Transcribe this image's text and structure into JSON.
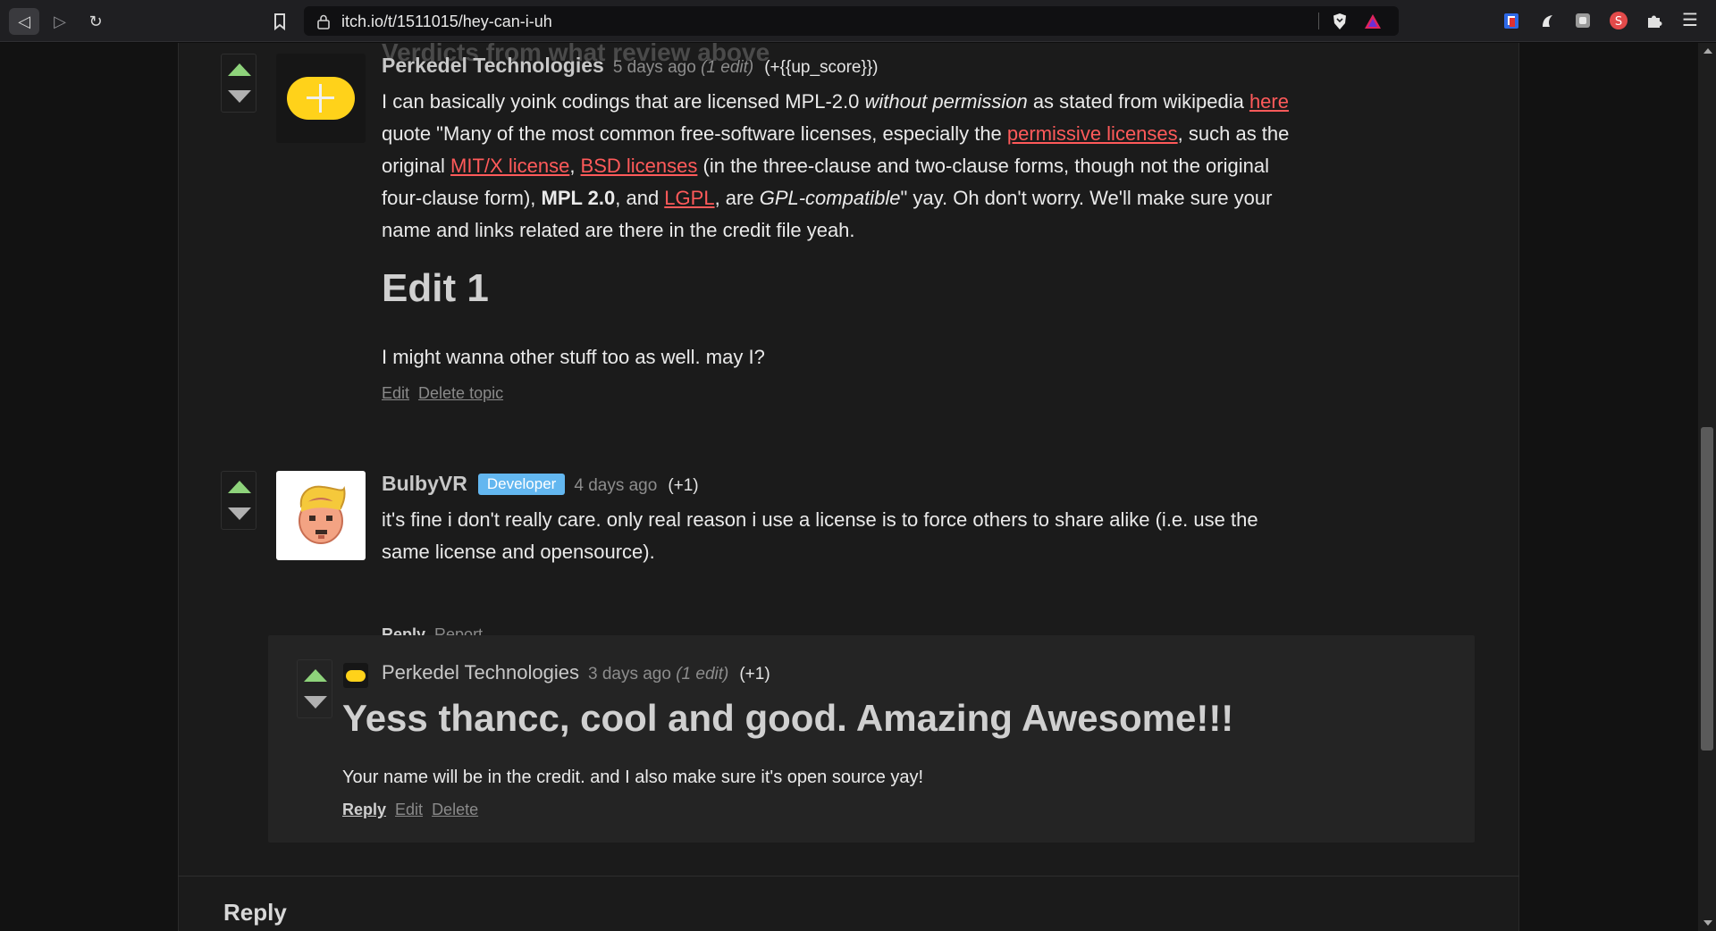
{
  "browser": {
    "url": "itch.io/t/1511015/hey-can-i-uh"
  },
  "page": {
    "ghost_heading": "Verdicts from what review above",
    "reply_heading": "Reply"
  },
  "post1": {
    "author": "Perkedel Technologies",
    "time": "5 days ago",
    "edit_note": "(1 edit)",
    "score": "(+{{up_score}})",
    "edit_heading": "Edit 1",
    "edit_text": "I might wanna other stuff too as well. may I?",
    "actions": [
      "Edit",
      "Delete topic"
    ],
    "body": {
      "t1": "I can basically yoink codings that are licensed MPL-2.0 ",
      "t1_em": "without permission",
      "t2": " as stated from wikipedia ",
      "link_here": "here",
      "t3": "quote \"Many of the most common free-software licenses, especially the ",
      "link_permissive": "permissive licenses",
      "t4": ", such as the original ",
      "link_mit": "MIT/X license",
      "t5": ", ",
      "link_bsd": "BSD licenses",
      "t6": " (in the three-clause and two-clause forms, though not the original four-clause form), ",
      "mpl_strong": "MPL 2.0",
      "t7": ", and ",
      "link_lgpl": "LGPL",
      "t8": ", are ",
      "gpl_em": "GPL-compatible",
      "t9": "\" yay. Oh don't worry. We'll make sure your name and links related are there in the credit file yeah."
    }
  },
  "post2": {
    "author": "BulbyVR",
    "badge": "Developer",
    "time": "4 days ago",
    "score": "(+1)",
    "body": "it's fine i don't really care.  only real reason i use a license is to force others to share alike (i.e. use the same license and opensource).",
    "actions": [
      "Reply",
      "Report"
    ]
  },
  "post3": {
    "author": "Perkedel Technologies",
    "time": "3 days ago",
    "edit_note": "(1 edit)",
    "score": "(+1)",
    "heading": "Yess thancc, cool and good. Amazing Awesome!!!",
    "body": "Your name will be in the credit. and I also make sure it's open source yay!",
    "actions": [
      "Reply",
      "Edit",
      "Delete"
    ]
  },
  "colors": {
    "link": "#ff5a5a",
    "upvote": "#8ed37b",
    "badge": "#63b7f0",
    "avatar_yellow": "#ffd21a"
  }
}
